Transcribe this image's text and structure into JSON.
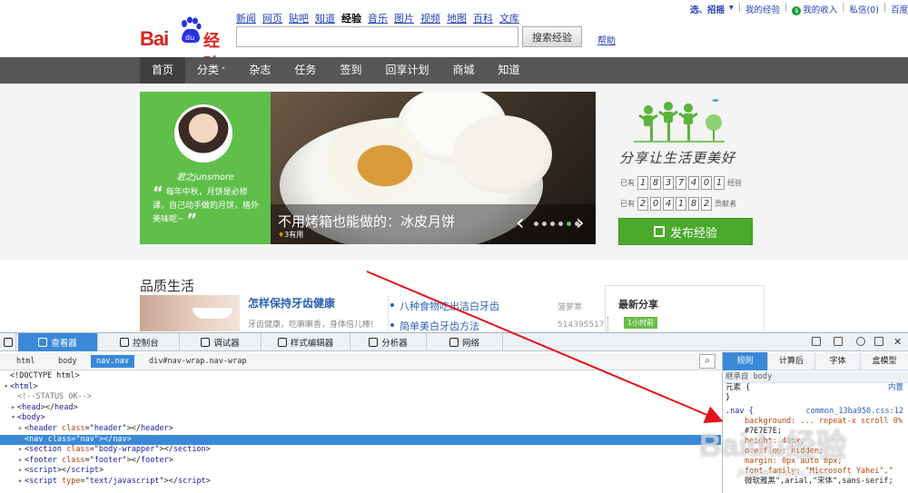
{
  "header": {
    "logo_text": "Bai",
    "logo_badge": "du",
    "logo_product": "经验",
    "nav_links": [
      "新闻",
      "网页",
      "贴吧",
      "知道",
      "经验",
      "音乐",
      "图片",
      "视频",
      "地图",
      "百科",
      "文库"
    ],
    "active_nav": "经验",
    "search_placeholder": "",
    "search_button": "搜索经验",
    "help_link": "帮助",
    "user": {
      "username": "选、招摇",
      "my_experience": "我的经验",
      "my_income": "我的收入",
      "messages": "私信(0)",
      "home": "百度首页",
      "coin_icon": "coin-icon"
    }
  },
  "main_nav": {
    "items": [
      "首页",
      "分类",
      "杂志",
      "任务",
      "签到",
      "回享计划",
      "商城",
      "知道"
    ],
    "active": "首页",
    "dropdown_item": "分类"
  },
  "banner": {
    "author_name": "君之junsmore",
    "quote": "每年中秋，月饼是必修课，自己动手做的月饼，格外美味呢~",
    "title": "不用烤箱也能做的：冰皮月饼",
    "usage": "3有用",
    "dots_count": 6,
    "active_dot": 5
  },
  "sidebar": {
    "slogan": "分享让生活更美好",
    "stats": [
      {
        "prefix": "已有",
        "digits": [
          "1",
          "8",
          "3",
          "7",
          "4",
          "0",
          "1"
        ],
        "suffix": "经验"
      },
      {
        "prefix": "已有",
        "digits": [
          "2",
          "0",
          "4",
          "1",
          "8",
          "2"
        ],
        "suffix": "贡献者"
      }
    ],
    "publish_button": "发布经验"
  },
  "quality": {
    "heading": "品质生活",
    "feature_title": "怎样保持牙齿健康",
    "feature_desc": "牙齿健康，吃嘛嘛香，身体倍儿棒!",
    "list": [
      {
        "title": "八种食物吃出洁白牙齿",
        "author": "菠萝寒"
      },
      {
        "title": "简单美白牙齿方法",
        "author": "514395517"
      }
    ],
    "latest_heading": "最新分享",
    "latest_ago": "1小时前"
  },
  "devtools": {
    "tabs": [
      "查看器",
      "控制台",
      "调试器",
      "样式编辑器",
      "分析器",
      "网络"
    ],
    "active_tab": "查看器",
    "breadcrumb": [
      "html",
      "body",
      "nav.nav",
      "div#nav-wrap.nav-wrap"
    ],
    "active_breadcrumb": "nav.nav",
    "markup_lines": [
      {
        "indent": 0,
        "twisty": "",
        "text": "<!DOCTYPE html>",
        "kind": "doctype"
      },
      {
        "indent": 0,
        "twisty": "▾",
        "tag": "html",
        "kind": "open"
      },
      {
        "indent": 1,
        "twisty": "",
        "text": "<!--STATUS OK-->",
        "kind": "comment"
      },
      {
        "indent": 1,
        "twisty": "▸",
        "tag": "head",
        "kind": "pair"
      },
      {
        "indent": 1,
        "twisty": "▾",
        "tag": "body",
        "kind": "open"
      },
      {
        "indent": 2,
        "twisty": "▸",
        "tag": "header",
        "attr": "class",
        "val": "header",
        "kind": "pair"
      },
      {
        "indent": 2,
        "twisty": "▸",
        "tag": "nav",
        "attr": "class",
        "val": "nav",
        "kind": "pair",
        "selected": true
      },
      {
        "indent": 2,
        "twisty": "▸",
        "tag": "section",
        "attr": "class",
        "val": "body-wrapper",
        "kind": "pair"
      },
      {
        "indent": 2,
        "twisty": "▸",
        "tag": "footer",
        "attr": "class",
        "val": "footer",
        "kind": "pair"
      },
      {
        "indent": 2,
        "twisty": "▸",
        "tag": "script",
        "kind": "pair"
      },
      {
        "indent": 2,
        "twisty": "▸",
        "tag": "script",
        "attr": "type",
        "val": "text/javascript",
        "kind": "pair"
      }
    ],
    "rules_tabs": [
      "规则",
      "计算后",
      "字体",
      "盒模型"
    ],
    "active_rules_tab": "规则",
    "inherited_from": "继承自 body",
    "element_rule": "元素 {",
    "element_rule_close": "}",
    "inline_label": "内置",
    "nav_rule": {
      "selector": ".nav {",
      "source": "common_13ba950.css:12",
      "props": [
        "background: ... repeat-x scroll 0%",
        "#7E7E7E;",
        "height: 40px;",
        "overflow: hidden;",
        "margin: 0px auto 0px;",
        "font-family: \"Microsoft Yahei\",\"",
        "微软雅黑\",arial,\"宋体\",sans-serif;"
      ]
    }
  },
  "watermark": {
    "main": "Baidu经验",
    "sub": "jingyan.baidu.com"
  },
  "colors": {
    "brand_red": "#d9251d",
    "brand_blue": "#2932e1",
    "nav_bg": "#565656",
    "green": "#5fbf4a",
    "devtools_accent": "#3a89d8",
    "arrow_red": "#e3131b"
  }
}
